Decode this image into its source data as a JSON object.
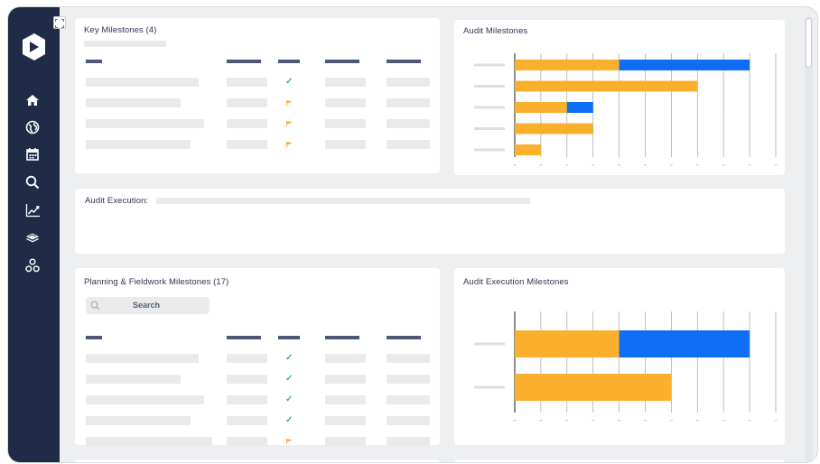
{
  "key_milestones": {
    "title": "Key Milestones (4)",
    "rows": [
      {
        "status": "check"
      },
      {
        "status": "flag"
      },
      {
        "status": "flag"
      },
      {
        "status": "flag"
      }
    ]
  },
  "audit_milestones": {
    "title": "Audit Milestones",
    "chart_data": {
      "type": "bar",
      "orientation": "horizontal",
      "stacked": true,
      "categories": [
        "",
        "",
        "",
        "",
        ""
      ],
      "series": [
        {
          "color": "#fbb02d",
          "values": [
            4,
            7,
            2,
            3,
            1
          ]
        },
        {
          "color": "#0e6ef5",
          "values": [
            5,
            0,
            1,
            0,
            0
          ]
        }
      ],
      "xlim": [
        0,
        10
      ],
      "grid": true
    }
  },
  "audit_execution": {
    "label": "Audit Execution:"
  },
  "planning_milestones": {
    "title": "Planning & Fieldwork Milestones (17)",
    "search_label": "Search",
    "rows": [
      {
        "status": "check"
      },
      {
        "status": "check"
      },
      {
        "status": "check"
      },
      {
        "status": "check"
      },
      {
        "status": "flag"
      }
    ]
  },
  "audit_execution_milestones": {
    "title": "Audit Execution Milestones",
    "chart_data": {
      "type": "bar",
      "orientation": "horizontal",
      "stacked": true,
      "categories": [
        "",
        ""
      ],
      "series": [
        {
          "color": "#fbb02d",
          "values": [
            4,
            6
          ]
        },
        {
          "color": "#0e6ef5",
          "values": [
            5,
            0
          ]
        }
      ],
      "xlim": [
        0,
        10
      ],
      "grid": true
    }
  },
  "colors": {
    "sidebar": "#1f2b47",
    "accent_orange": "#fbb02d",
    "accent_blue": "#0e6ef5",
    "check_green": "#3dbb5a"
  },
  "nav_icons": [
    "home-icon",
    "globe-icon",
    "calendar-icon",
    "search-icon",
    "chart-line-icon",
    "layers-icon",
    "network-icon"
  ]
}
